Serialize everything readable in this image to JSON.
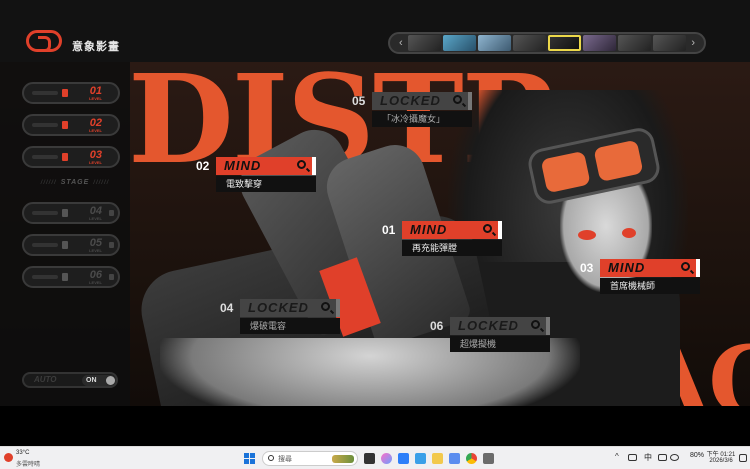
{
  "app": {
    "title": "意象影畫"
  },
  "scene": {
    "background_text_top": "DISTR",
    "background_text_bottom": "GRAC",
    "background_quote": "“"
  },
  "sidebar": {
    "levels": [
      {
        "num": "01",
        "sub": "LEVEL",
        "state": "active"
      },
      {
        "num": "02",
        "sub": "LEVEL",
        "state": "active"
      },
      {
        "num": "03",
        "sub": "LEVEL",
        "state": "active"
      },
      {
        "num": "04",
        "sub": "LEVEL",
        "state": "locked"
      },
      {
        "num": "05",
        "sub": "LEVEL",
        "state": "locked"
      },
      {
        "num": "06",
        "sub": "LEVEL",
        "state": "locked"
      }
    ],
    "stage_label": "STAGE",
    "auto_label": "AUTO",
    "auto_value": "ON"
  },
  "nodes": [
    {
      "num": "05",
      "head": "LOCKED",
      "name": "「冰冷攝魔女」",
      "locked": true
    },
    {
      "num": "02",
      "head": "MIND",
      "name": "電致擊穿",
      "locked": false
    },
    {
      "num": "01",
      "head": "MIND",
      "name": "再充能彈膛",
      "locked": false
    },
    {
      "num": "03",
      "head": "MIND",
      "name": "首席機械師",
      "locked": false
    },
    {
      "num": "04",
      "head": "LOCKED",
      "name": "爆破電容",
      "locked": true
    },
    {
      "num": "06",
      "head": "LOCKED",
      "name": "超爆擬機",
      "locked": true
    }
  ],
  "taskbar": {
    "weather_temp": "33°C",
    "weather_desc": "多雲時晴",
    "search_placeholder": "搜尋",
    "language": "中",
    "battery": "80%",
    "time": "下午 01:21",
    "date": "2026/3/6"
  },
  "colors": {
    "accent": "#e0402a",
    "highlight": "#ecd84a"
  }
}
